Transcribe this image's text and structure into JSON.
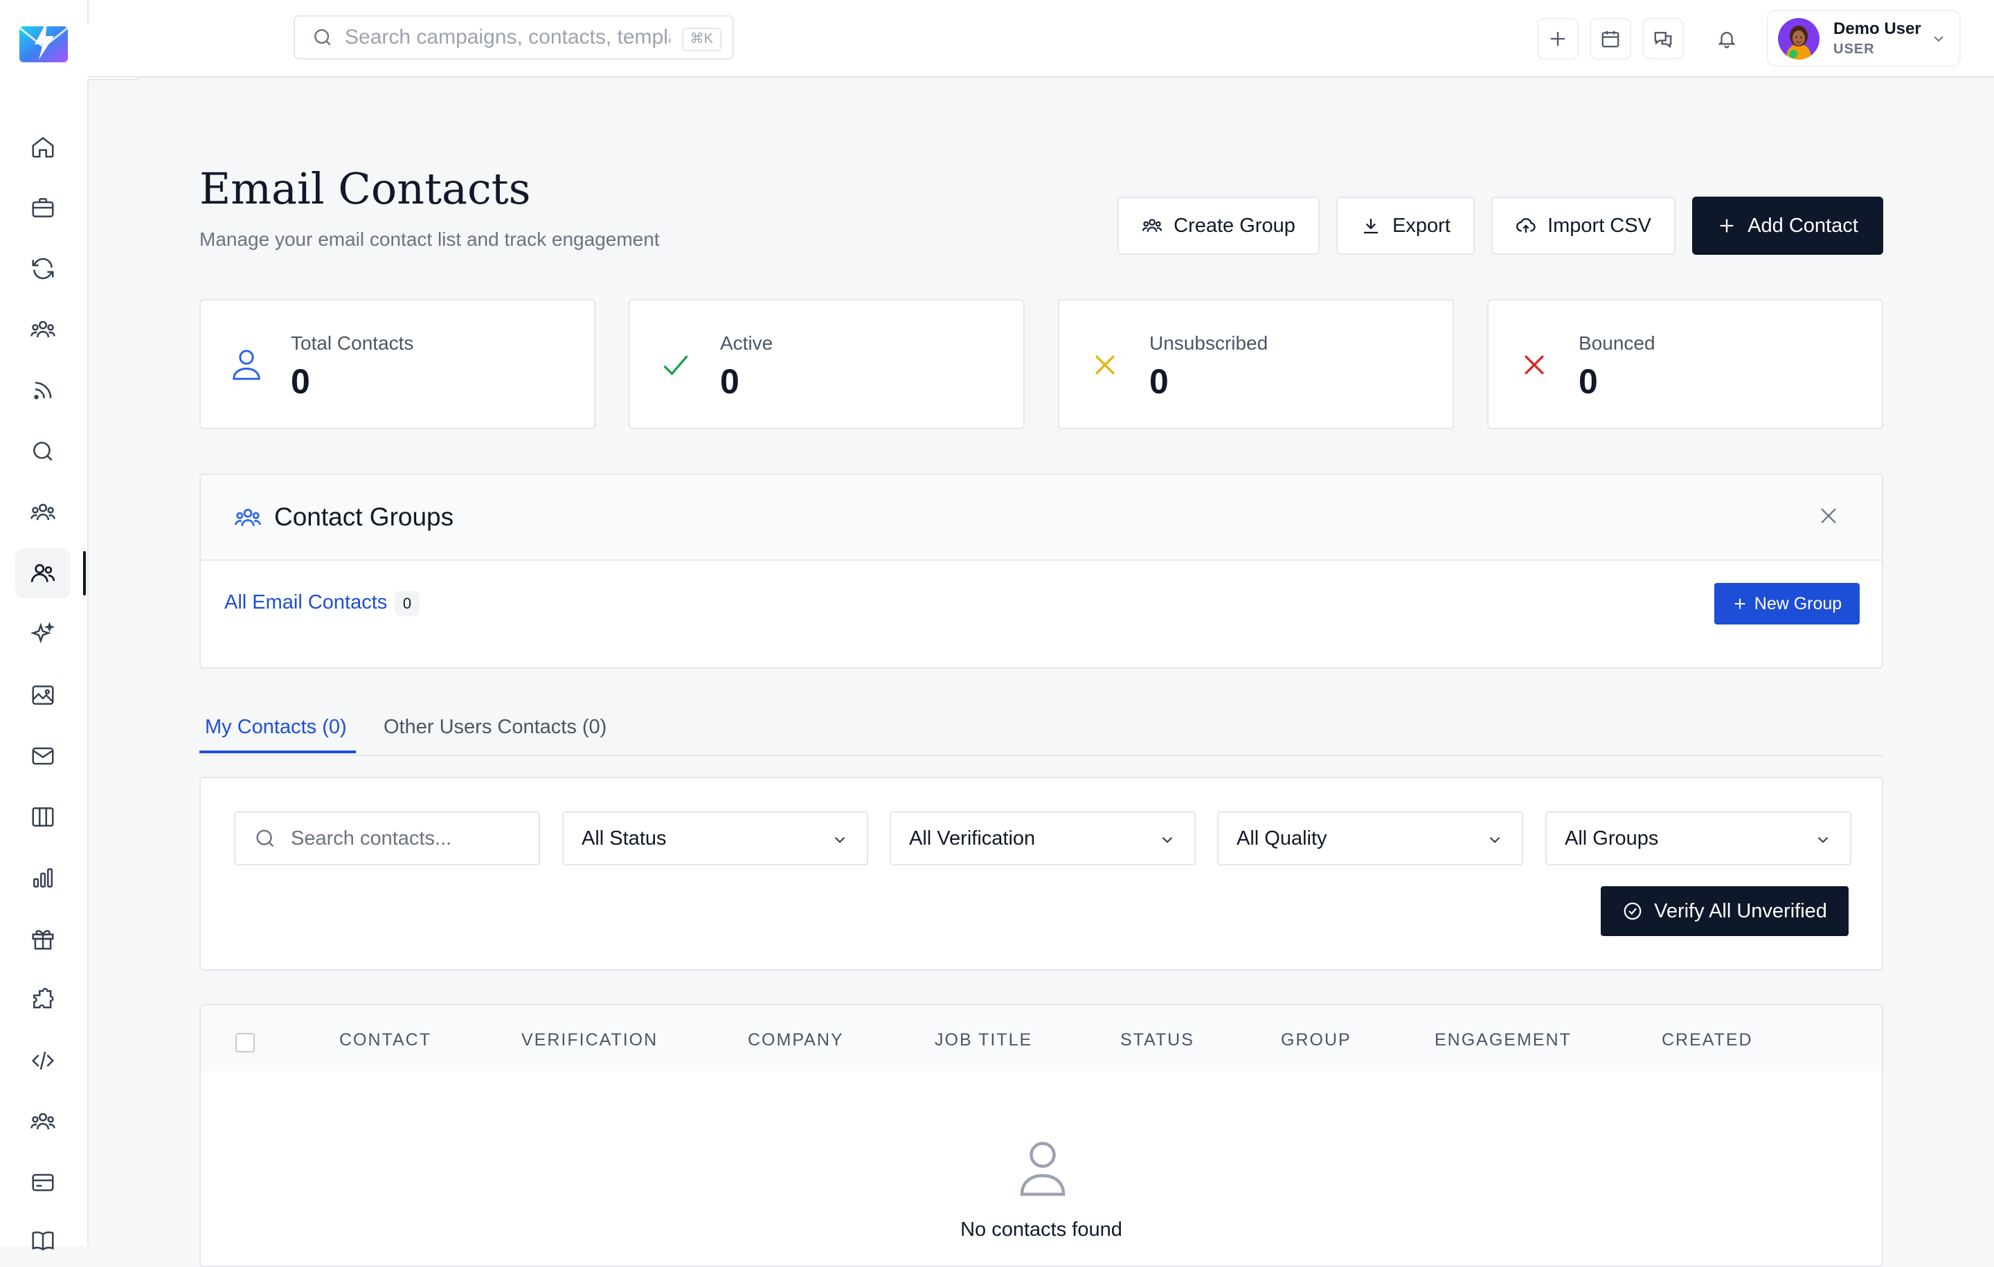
{
  "topbar": {
    "search_placeholder": "Search campaigns, contacts, templa",
    "search_shortcut": "⌘K",
    "user_name": "Demo User",
    "user_role": "USER"
  },
  "header": {
    "title": "Email Contacts",
    "subtitle": "Manage your email contact list and track engagement",
    "buttons": {
      "create_group": "Create Group",
      "export": "Export",
      "import_csv": "Import CSV",
      "add_contact": "Add Contact"
    }
  },
  "stats": [
    {
      "label": "Total Contacts",
      "value": "0",
      "color": "#2563eb",
      "icon": "user-icon"
    },
    {
      "label": "Active",
      "value": "0",
      "color": "#16a34a",
      "icon": "check-icon"
    },
    {
      "label": "Unsubscribed",
      "value": "0",
      "color": "#eab308",
      "icon": "x-icon"
    },
    {
      "label": "Bounced",
      "value": "0",
      "color": "#dc2626",
      "icon": "x-icon"
    }
  ],
  "groups": {
    "title": "Contact Groups",
    "all_label": "All Email Contacts",
    "all_count": "0",
    "new_group": "New Group"
  },
  "tabs": [
    {
      "label": "My Contacts (0)",
      "active": true
    },
    {
      "label": "Other Users Contacts (0)",
      "active": false
    }
  ],
  "filters": {
    "search_placeholder": "Search contacts...",
    "status": "All Status",
    "verification": "All Verification",
    "quality": "All Quality",
    "groups": "All Groups",
    "verify_all": "Verify All Unverified"
  },
  "table": {
    "columns": [
      "CONTACT",
      "VERIFICATION",
      "COMPANY",
      "JOB TITLE",
      "STATUS",
      "GROUP",
      "ENGAGEMENT",
      "CREATED"
    ],
    "empty_text": "No contacts found"
  },
  "sidebar": {
    "items": [
      "home-icon",
      "briefcase-icon",
      "refresh-icon",
      "group-icon",
      "rss-icon",
      "search-icon",
      "team-icon",
      "contacts-icon",
      "sparkles-icon",
      "image-icon",
      "mail-icon",
      "columns-icon",
      "bar-chart-icon",
      "gift-icon",
      "puzzle-icon",
      "code-icon",
      "users-icon",
      "credit-card-icon",
      "book-icon"
    ],
    "active_item": "contacts-icon"
  }
}
